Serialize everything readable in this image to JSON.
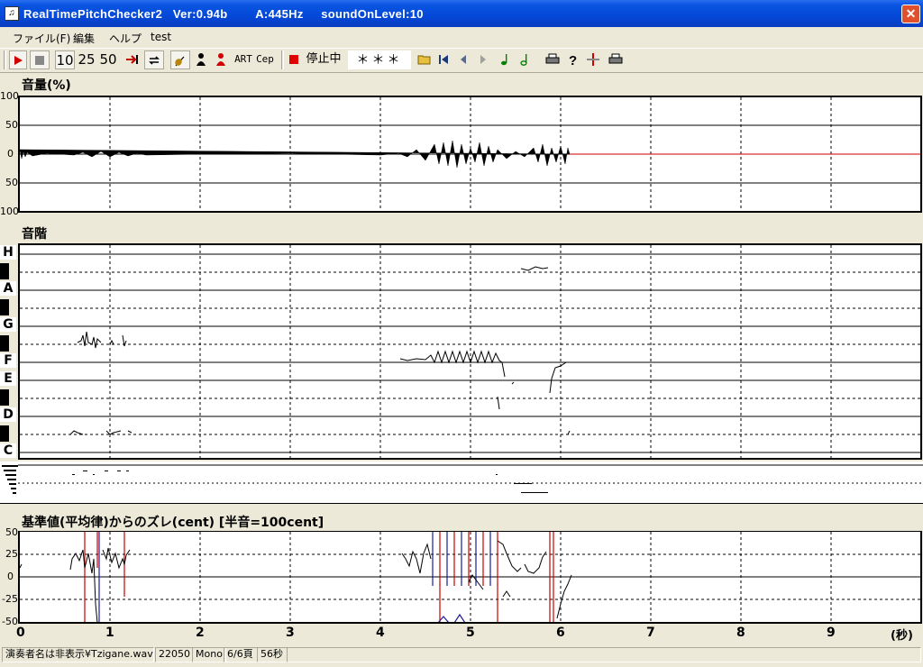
{
  "window": {
    "title": "RealTimePitchChecker2   Ver:0.94b        A:445Hz     soundOnLevel:10",
    "close_symbol": "✕"
  },
  "menu": [
    "ファイル(F)",
    "編集",
    "ヘルプ",
    "test"
  ],
  "toolbar": {
    "play_icon": "play-icon",
    "stop_icon": "stop-icon",
    "zoom_options": [
      "10",
      "25",
      "50"
    ],
    "art_label": "ART",
    "cep_label": "Cep",
    "status_label": "停止中",
    "note_display": "＊＊＊"
  },
  "volume_panel": {
    "title": "音量(%)",
    "y_labels": [
      "100",
      "50",
      "0",
      "50",
      "100"
    ]
  },
  "scale_panel": {
    "title": "音階",
    "notes": [
      "H",
      "A",
      "G",
      "F",
      "E",
      "D",
      "C"
    ]
  },
  "deviation_panel": {
    "title": "基準値(平均律)からのズレ(cent) [半音=100cent]",
    "y_labels": [
      "50",
      "25",
      "0",
      "-25",
      "-50"
    ]
  },
  "x_axis": {
    "ticks": [
      "0",
      "1",
      "2",
      "3",
      "4",
      "5",
      "6",
      "7",
      "8",
      "9"
    ],
    "unit": "(秒)"
  },
  "statusbar": {
    "file": "演奏者名は非表示¥Tzigane.wav",
    "rate": "22050",
    "channels": "Mono",
    "page": "6/6頁",
    "duration": "56秒"
  },
  "colors": {
    "title_blue": "#0a55e2",
    "marker_red": "#cc0000",
    "deviation_blue": "#1a1aa0"
  }
}
